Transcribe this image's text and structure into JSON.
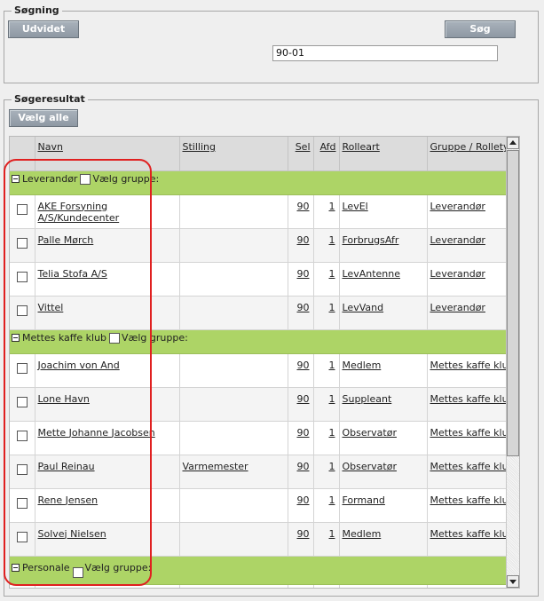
{
  "search": {
    "legend": "Søgning",
    "advanced_button": "Udvidet",
    "search_button": "Søg",
    "query_value": "90-01"
  },
  "results": {
    "legend": "Søgeresultat",
    "select_all_button": "Vælg alle",
    "columns": [
      "Navn",
      "Stilling",
      "Sel",
      "Afd",
      "Rolleart",
      "Gruppe / Rolletype"
    ],
    "group_select_label": "Vælg gruppe:",
    "groups": [
      {
        "name": "Leverandør",
        "rows": [
          {
            "navn": "AKE Forsyning A/S/Kundecenter",
            "stilling": "",
            "sel": "90",
            "afd": "1",
            "rolleart": "LevEl",
            "gruppe": "Leverandør"
          },
          {
            "navn": "Palle Mørch",
            "stilling": "",
            "sel": "90",
            "afd": "1",
            "rolleart": "ForbrugsAfr",
            "gruppe": "Leverandør"
          },
          {
            "navn": "Telia Stofa A/S",
            "stilling": "",
            "sel": "90",
            "afd": "1",
            "rolleart": "LevAntenne",
            "gruppe": "Leverandør"
          },
          {
            "navn": "Vittel",
            "stilling": "",
            "sel": "90",
            "afd": "1",
            "rolleart": "LevVand",
            "gruppe": "Leverandør"
          }
        ]
      },
      {
        "name": "Mettes kaffe klub",
        "rows": [
          {
            "navn": "Joachim von And",
            "stilling": "",
            "sel": "90",
            "afd": "1",
            "rolleart": "Medlem",
            "gruppe": "Mettes kaffe klub"
          },
          {
            "navn": "Lone Havn",
            "stilling": "",
            "sel": "90",
            "afd": "1",
            "rolleart": "Suppleant",
            "gruppe": "Mettes kaffe klub"
          },
          {
            "navn": "Mette Johanne Jacobsen",
            "stilling": "",
            "sel": "90",
            "afd": "1",
            "rolleart": "Observatør",
            "gruppe": "Mettes kaffe klub"
          },
          {
            "navn": "Paul Reinau",
            "stilling": "Varmemester",
            "sel": "90",
            "afd": "1",
            "rolleart": "Observatør",
            "gruppe": "Mettes kaffe klub"
          },
          {
            "navn": "Rene Jensen",
            "stilling": "",
            "sel": "90",
            "afd": "1",
            "rolleart": "Formand",
            "gruppe": "Mettes kaffe klub"
          },
          {
            "navn": "Solvej Nielsen",
            "stilling": "",
            "sel": "90",
            "afd": "1",
            "rolleart": "Medlem",
            "gruppe": "Mettes kaffe klub"
          }
        ]
      },
      {
        "name": "Personale",
        "rows": []
      }
    ]
  }
}
